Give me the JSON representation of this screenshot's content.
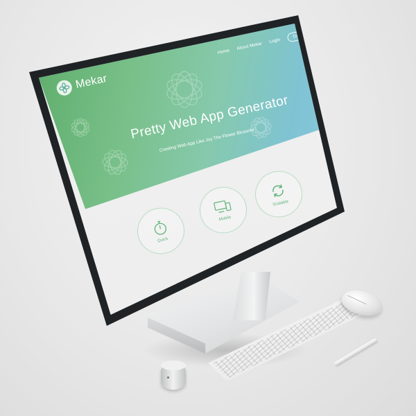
{
  "app": {
    "brand": "Mekar"
  },
  "nav": {
    "items": [
      "Home",
      "About Mekar",
      "Login"
    ],
    "cta": "Data"
  },
  "hero": {
    "title": "Pretty Web App Generator",
    "subtitle": "Creating Web App Like Joy The Flower Blossom"
  },
  "features": [
    {
      "label": "Quick",
      "icon": "stopwatch-icon"
    },
    {
      "label": "Mobile",
      "icon": "devices-icon"
    },
    {
      "label": "Scalable",
      "icon": "refresh-icon"
    }
  ],
  "colors": {
    "hero_start": "#5fae6c",
    "hero_end": "#8fcbe0",
    "feature_accent": "#5fb37a",
    "bezel": "#1f2326"
  }
}
